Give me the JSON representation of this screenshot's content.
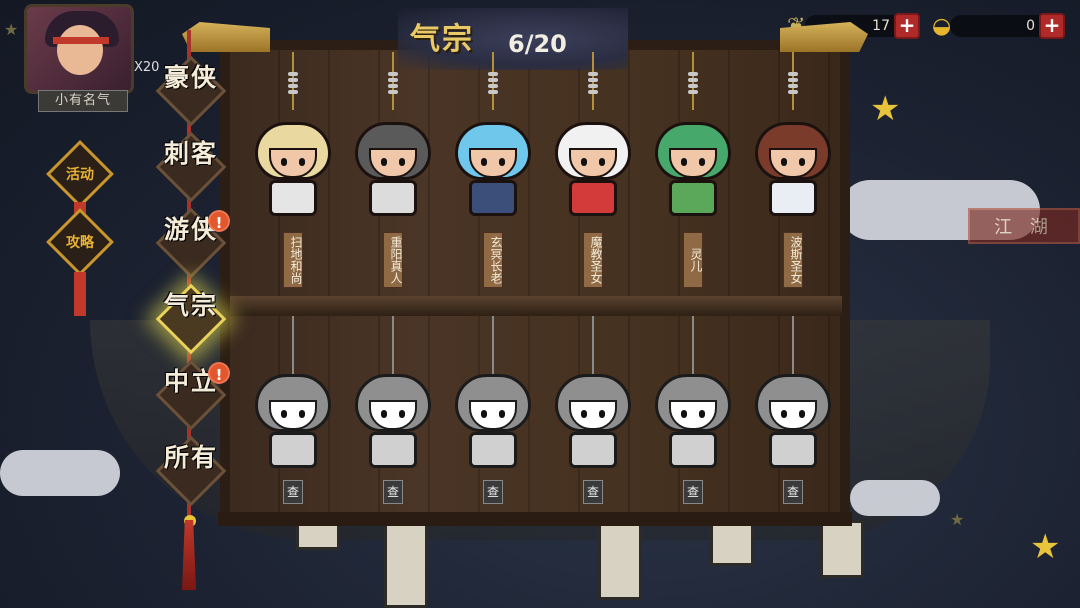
{
  "header": {
    "title": "气宗",
    "progress": "6/20"
  },
  "player": {
    "fame_title": "小有名气",
    "badge": "X20"
  },
  "resources": [
    {
      "icon": "jade-ingot-icon",
      "value": "17"
    },
    {
      "icon": "gold-ingot-icon",
      "value": "0"
    }
  ],
  "side_activities": [
    {
      "label": "活动"
    },
    {
      "label": "攻略"
    }
  ],
  "jianghu_button": "江 湖",
  "categories": [
    {
      "label": "豪侠",
      "active": false,
      "alert": false
    },
    {
      "label": "刺客",
      "active": false,
      "alert": false
    },
    {
      "label": "游侠",
      "active": false,
      "alert": true
    },
    {
      "label": "气宗",
      "active": true,
      "alert": false
    },
    {
      "label": "中立",
      "active": false,
      "alert": true
    },
    {
      "label": "所有",
      "active": false,
      "alert": false
    }
  ],
  "alert_symbol": "!",
  "unlocked_heroes": [
    {
      "name": "扫地和尚",
      "hair": "#e9d9a0",
      "outfit": "#e5e5e5"
    },
    {
      "name": "重阳真人",
      "hair": "#5a5a5a",
      "outfit": "#dcdcdc"
    },
    {
      "name": "玄冥长老",
      "hair": "#6fc7ec",
      "outfit": "#3b4f7a"
    },
    {
      "name": "魔教圣女",
      "hair": "#f1f1f1",
      "outfit": "#d33a3a"
    },
    {
      "name": "灵儿",
      "hair": "#46a86b",
      "outfit": "#5ba85a"
    },
    {
      "name": "波斯圣女",
      "hair": "#7a3b2a",
      "outfit": "#e8eef3"
    }
  ],
  "locked_heroes": [
    {
      "check_label": "查"
    },
    {
      "check_label": "查"
    },
    {
      "check_label": "查"
    },
    {
      "check_label": "查"
    },
    {
      "check_label": "查"
    },
    {
      "check_label": "查"
    }
  ],
  "colors": {
    "title_gold": "#e9c866",
    "active_glow": "#e8d25a",
    "alert_orange": "#e4562b",
    "cord_red": "#a8332a"
  }
}
